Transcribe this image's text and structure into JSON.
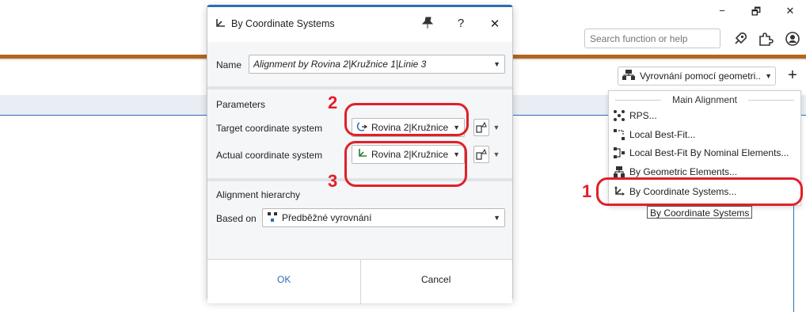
{
  "app": {
    "window_controls": [
      "−",
      "🗗",
      "✕"
    ],
    "search": {
      "placeholder": "Search function or help"
    },
    "toolbar_icons": [
      "rocket-icon",
      "puzzle-icon",
      "user-help-icon"
    ],
    "alignment_combo": {
      "value": "Vyrovnání pomocí geometri..",
      "add_label": "+"
    }
  },
  "menu": {
    "header": "Main Alignment",
    "items": [
      {
        "label": "RPS...",
        "icon": "rps-icon"
      },
      {
        "label": "Local Best-Fit...",
        "icon": "local-bestfit-icon"
      },
      {
        "label": "Local Best-Fit By Nominal Elements...",
        "icon": "local-bestfit-nominal-icon"
      },
      {
        "label": "By Geometric Elements...",
        "icon": "geometric-elements-icon"
      },
      {
        "label": "By Coordinate Systems...",
        "icon": "coordinate-systems-icon"
      }
    ],
    "tooltip": "By Coordinate Systems"
  },
  "dialog": {
    "title": "By Coordinate Systems",
    "title_buttons": {
      "pin": "pin-icon",
      "help": "?",
      "close": "✕"
    },
    "name_label": "Name",
    "name_value": "Alignment by Rovina 2|Kružnice 1|Linie 3",
    "parameters_header": "Parameters",
    "target_label": "Target coordinate system",
    "target_value": "Rovina 2|Kružnice..",
    "actual_label": "Actual coordinate system",
    "actual_value": "Rovina 2|Kružnice..",
    "hierarchy_header": "Alignment hierarchy",
    "based_on_label": "Based on",
    "based_on_value": "Předběžné vyrovnání",
    "ok_label": "OK",
    "cancel_label": "Cancel"
  },
  "annotations": [
    "1",
    "2",
    "3"
  ],
  "colors": {
    "accent": "#2d6db5",
    "annotation": "#e0202a",
    "brand_bar": "#b5651d"
  }
}
